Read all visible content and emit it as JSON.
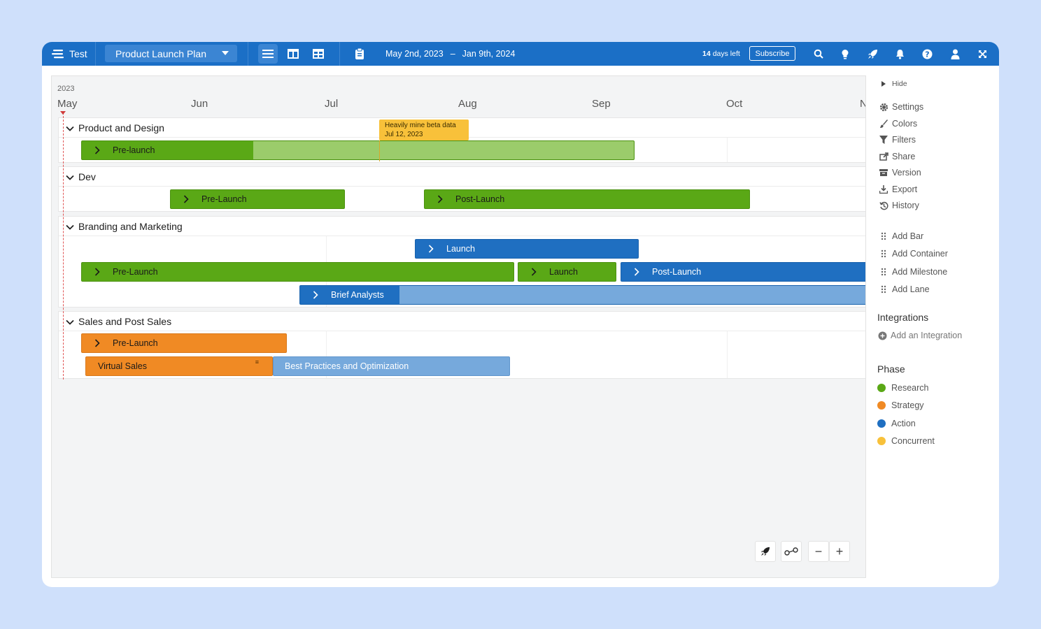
{
  "topbar": {
    "workspace": "Test",
    "plan_name": "Product Launch Plan",
    "date_start": "May 2nd, 2023",
    "date_dash": "–",
    "date_end": "Jan 9th, 2024",
    "trial_days": "14",
    "trial_suffix": "days left",
    "subscribe": "Subscribe"
  },
  "timeline": {
    "year": "2023",
    "months": [
      "May",
      "Jun",
      "Jul",
      "Aug",
      "Sep",
      "Oct",
      "N"
    ]
  },
  "milestone": {
    "title": "Heavily mine beta data",
    "date": "Jul 12, 2023",
    "color": "#f8c13a"
  },
  "lanes": [
    {
      "title": "Product and Design",
      "bars": [
        {
          "label": "Pre-launch"
        }
      ]
    },
    {
      "title": "Dev",
      "bars": [
        {
          "label": "Pre-Launch"
        },
        {
          "label": "Post-Launch"
        }
      ]
    },
    {
      "title": "Branding and Marketing",
      "bars": [
        {
          "label": "Launch"
        },
        {
          "label": "Pre-Launch"
        },
        {
          "label": "Launch"
        },
        {
          "label": "Post-Launch"
        },
        {
          "label": "Brief Analysts"
        }
      ]
    },
    {
      "title": "Sales and Post Sales",
      "bars": [
        {
          "label": "Pre-Launch"
        },
        {
          "label": "Virtual Sales"
        },
        {
          "label": "Best Practices and Optimization"
        }
      ]
    }
  ],
  "sidebar": {
    "hide": "Hide",
    "menu": [
      {
        "label": "Settings",
        "icon": "gear-icon"
      },
      {
        "label": "Colors",
        "icon": "brush-icon"
      },
      {
        "label": "Filters",
        "icon": "filter-icon"
      },
      {
        "label": "Share",
        "icon": "share-icon"
      },
      {
        "label": "Version",
        "icon": "archive-icon"
      },
      {
        "label": "Export",
        "icon": "download-icon"
      },
      {
        "label": "History",
        "icon": "history-icon"
      }
    ],
    "add": [
      {
        "label": "Add Bar"
      },
      {
        "label": "Add Container"
      },
      {
        "label": "Add Milestone"
      },
      {
        "label": "Add Lane"
      }
    ],
    "integrations_title": "Integrations",
    "add_integration": "Add an Integration",
    "phase_title": "Phase",
    "phases": [
      {
        "label": "Research",
        "color": "#5aa816"
      },
      {
        "label": "Strategy",
        "color": "#f08a24"
      },
      {
        "label": "Action",
        "color": "#1f6fc1"
      },
      {
        "label": "Concurrent",
        "color": "#f8c13a"
      }
    ]
  },
  "colors": {
    "topbar": "#1b6fc6",
    "green": "#5aa816",
    "blue": "#1f6fc1",
    "orange": "#f08a24",
    "yellow": "#f8c13a"
  }
}
